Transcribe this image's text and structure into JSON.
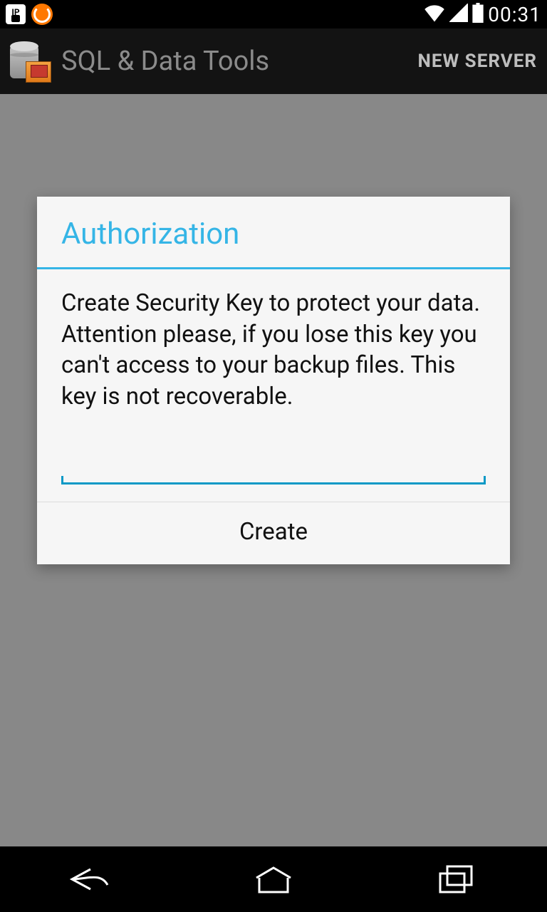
{
  "status_bar": {
    "time": "00:31"
  },
  "action_bar": {
    "title": "SQL & Data Tools",
    "action_label": "NEW SERVER"
  },
  "dialog": {
    "title": "Authorization",
    "body": "Create Security Key to protect your data.\nAttention please, if you lose this key you can't access to your backup files. This key is not recoverable.",
    "input_value": "",
    "create_label": "Create"
  }
}
